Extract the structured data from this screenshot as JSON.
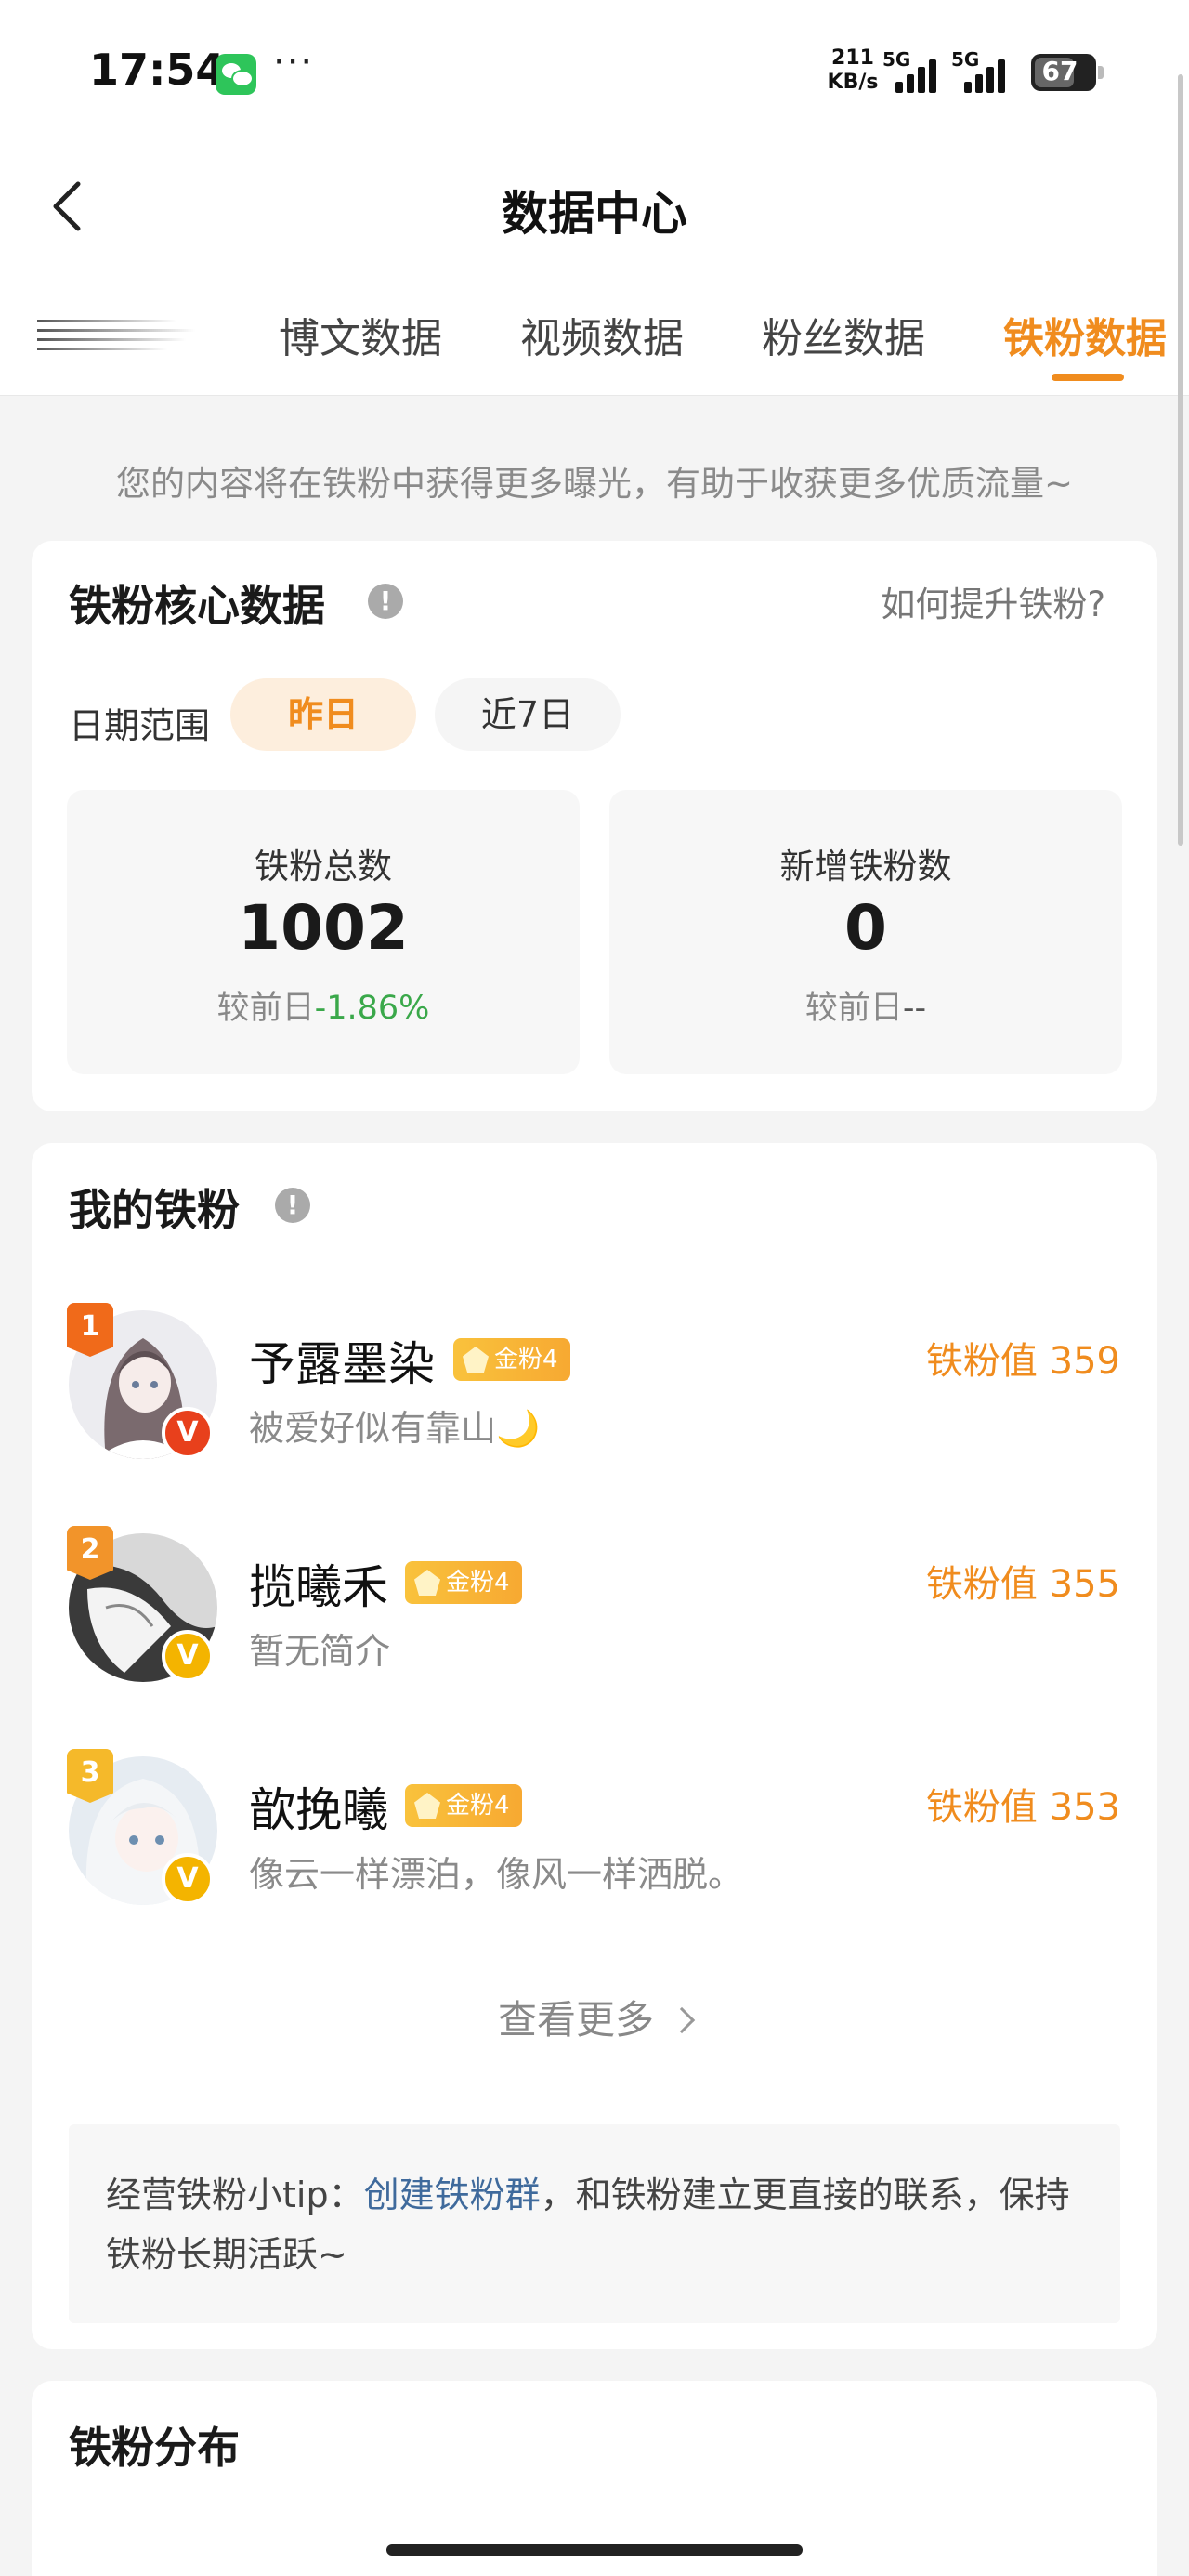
{
  "status_bar": {
    "time": "17:54",
    "more": "···",
    "net_speed_value": "211",
    "net_speed_unit": "KB/s",
    "signal_1": "5G",
    "signal_2": "5G",
    "battery": "67",
    "battery_level": 0.67,
    "icons": [
      "wechat-icon",
      "signal-icon",
      "battery-icon"
    ]
  },
  "nav": {
    "title": "数据中心",
    "back_icon": "chevron-left-icon"
  },
  "tabs": [
    {
      "label": "博文数据",
      "active": false
    },
    {
      "label": "视频数据",
      "active": false
    },
    {
      "label": "粉丝数据",
      "active": false
    },
    {
      "label": "铁粉数据",
      "active": true
    }
  ],
  "banner_note": "您的内容将在铁粉中获得更多曝光，有助于收获更多优质流量~",
  "core_card": {
    "title": "铁粉核心数据",
    "info_icon": "!",
    "how_link": "如何提升铁粉?",
    "date_range_label": "日期范围",
    "ranges": [
      "昨日",
      "近7日"
    ],
    "stats": [
      {
        "label": "铁粉总数",
        "value": "1002",
        "compare_prefix": "较前日",
        "compare_value": "-1.86%"
      },
      {
        "label": "新增铁粉数",
        "value": "0",
        "compare_prefix": "较前日",
        "compare_value": "--"
      }
    ]
  },
  "my_fans_card": {
    "title": "我的铁粉",
    "info_icon": "!",
    "fans": [
      {
        "rank": "1",
        "name": "予露墨染",
        "level": "金粉4",
        "bio": "被爱好似有靠山🌙",
        "score": "铁粉值 359",
        "verify": "V"
      },
      {
        "rank": "2",
        "name": "揽曦禾",
        "level": "金粉4",
        "bio": "暂无简介",
        "score": "铁粉值 355",
        "verify": "V"
      },
      {
        "rank": "3",
        "name": "歆挽曦",
        "level": "金粉4",
        "bio": "像云一样漂泊，像风一样洒脱。",
        "score": "铁粉值 353",
        "verify": "V"
      }
    ],
    "see_more": "查看更多",
    "tip_prefix": "经营铁粉小tip：",
    "tip_link": "创建铁粉群",
    "tip_suffix": "，和铁粉建立更直接的联系，保持铁粉长期活跃~"
  },
  "distribution_card": {
    "title": "铁粉分布"
  },
  "colors": {
    "accent": "#f08c1e",
    "decrease": "#3aa84a",
    "link": "#3f6a9c",
    "rank1": "#f06a1a",
    "rank2": "#f2942a",
    "rank3": "#f5b92a"
  }
}
